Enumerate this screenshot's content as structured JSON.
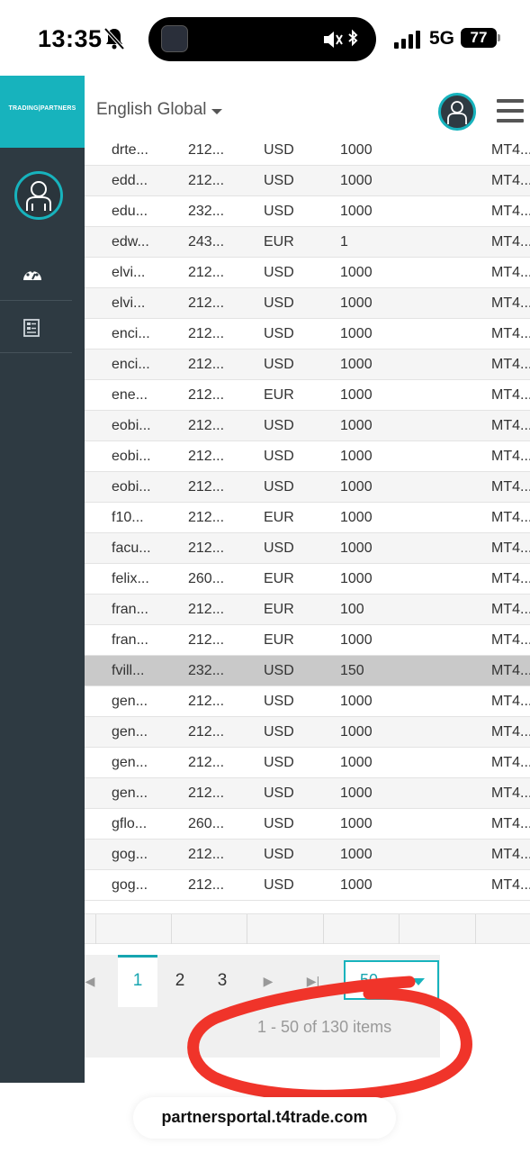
{
  "status_bar": {
    "time": "13:35",
    "network": "5G",
    "battery": "77",
    "bell_icon": "bell-slash-icon",
    "mute_icon": "speaker-muted-icon",
    "bluetooth_icon": "bluetooth-icon"
  },
  "sidebar": {
    "brand": "TRADING|PARTNERS",
    "brand_color": "#17b3bd",
    "background": "#2e3a42",
    "items": [
      {
        "icon": "dashboard-icon"
      },
      {
        "icon": "report-icon"
      }
    ]
  },
  "header": {
    "language": "English Global"
  },
  "table": {
    "columns_visible": 5,
    "rows": [
      {
        "c1": "drte...",
        "c2": "212...",
        "c3": "USD",
        "c4": "1000",
        "c5": "MT4..."
      },
      {
        "c1": "edd...",
        "c2": "212...",
        "c3": "USD",
        "c4": "1000",
        "c5": "MT4..."
      },
      {
        "c1": "edu...",
        "c2": "232...",
        "c3": "USD",
        "c4": "1000",
        "c5": "MT4..."
      },
      {
        "c1": "edw...",
        "c2": "243...",
        "c3": "EUR",
        "c4": "1",
        "c5": "MT4..."
      },
      {
        "c1": "elvi...",
        "c2": "212...",
        "c3": "USD",
        "c4": "1000",
        "c5": "MT4..."
      },
      {
        "c1": "elvi...",
        "c2": "212...",
        "c3": "USD",
        "c4": "1000",
        "c5": "MT4..."
      },
      {
        "c1": "enci...",
        "c2": "212...",
        "c3": "USD",
        "c4": "1000",
        "c5": "MT4..."
      },
      {
        "c1": "enci...",
        "c2": "212...",
        "c3": "USD",
        "c4": "1000",
        "c5": "MT4..."
      },
      {
        "c1": "ene...",
        "c2": "212...",
        "c3": "EUR",
        "c4": "1000",
        "c5": "MT4..."
      },
      {
        "c1": "eobi...",
        "c2": "212...",
        "c3": "USD",
        "c4": "1000",
        "c5": "MT4..."
      },
      {
        "c1": "eobi...",
        "c2": "212...",
        "c3": "USD",
        "c4": "1000",
        "c5": "MT4..."
      },
      {
        "c1": "eobi...",
        "c2": "212...",
        "c3": "USD",
        "c4": "1000",
        "c5": "MT4..."
      },
      {
        "c1": "f10...",
        "c2": "212...",
        "c3": "EUR",
        "c4": "1000",
        "c5": "MT4..."
      },
      {
        "c1": "facu...",
        "c2": "212...",
        "c3": "USD",
        "c4": "1000",
        "c5": "MT4..."
      },
      {
        "c1": "felix...",
        "c2": "260...",
        "c3": "EUR",
        "c4": "1000",
        "c5": "MT4..."
      },
      {
        "c1": "fran...",
        "c2": "212...",
        "c3": "EUR",
        "c4": "100",
        "c5": "MT4..."
      },
      {
        "c1": "fran...",
        "c2": "212...",
        "c3": "EUR",
        "c4": "1000",
        "c5": "MT4..."
      },
      {
        "c1": "fvill...",
        "c2": "232...",
        "c3": "USD",
        "c4": "150",
        "c5": "MT4..."
      },
      {
        "c1": "gen...",
        "c2": "212...",
        "c3": "USD",
        "c4": "1000",
        "c5": "MT4..."
      },
      {
        "c1": "gen...",
        "c2": "212...",
        "c3": "USD",
        "c4": "1000",
        "c5": "MT4..."
      },
      {
        "c1": "gen...",
        "c2": "212...",
        "c3": "USD",
        "c4": "1000",
        "c5": "MT4..."
      },
      {
        "c1": "gen...",
        "c2": "212...",
        "c3": "USD",
        "c4": "1000",
        "c5": "MT4..."
      },
      {
        "c1": "gflo...",
        "c2": "260...",
        "c3": "USD",
        "c4": "1000",
        "c5": "MT4..."
      },
      {
        "c1": "gog...",
        "c2": "212...",
        "c3": "USD",
        "c4": "1000",
        "c5": "MT4..."
      },
      {
        "c1": "gog...",
        "c2": "212...",
        "c3": "USD",
        "c4": "1000",
        "c5": "MT4..."
      }
    ],
    "selected_row": 17
  },
  "pager": {
    "pages": [
      "1",
      "2",
      "3"
    ],
    "current_page": "1",
    "page_size": "50",
    "info": "1 - 50 of 130 items",
    "accent": "#17a5b0"
  },
  "annotation": {
    "color": "#f0342a",
    "shape": "hand-drawn circle around items info"
  },
  "browser": {
    "url": "partnersportal.t4trade.com"
  }
}
